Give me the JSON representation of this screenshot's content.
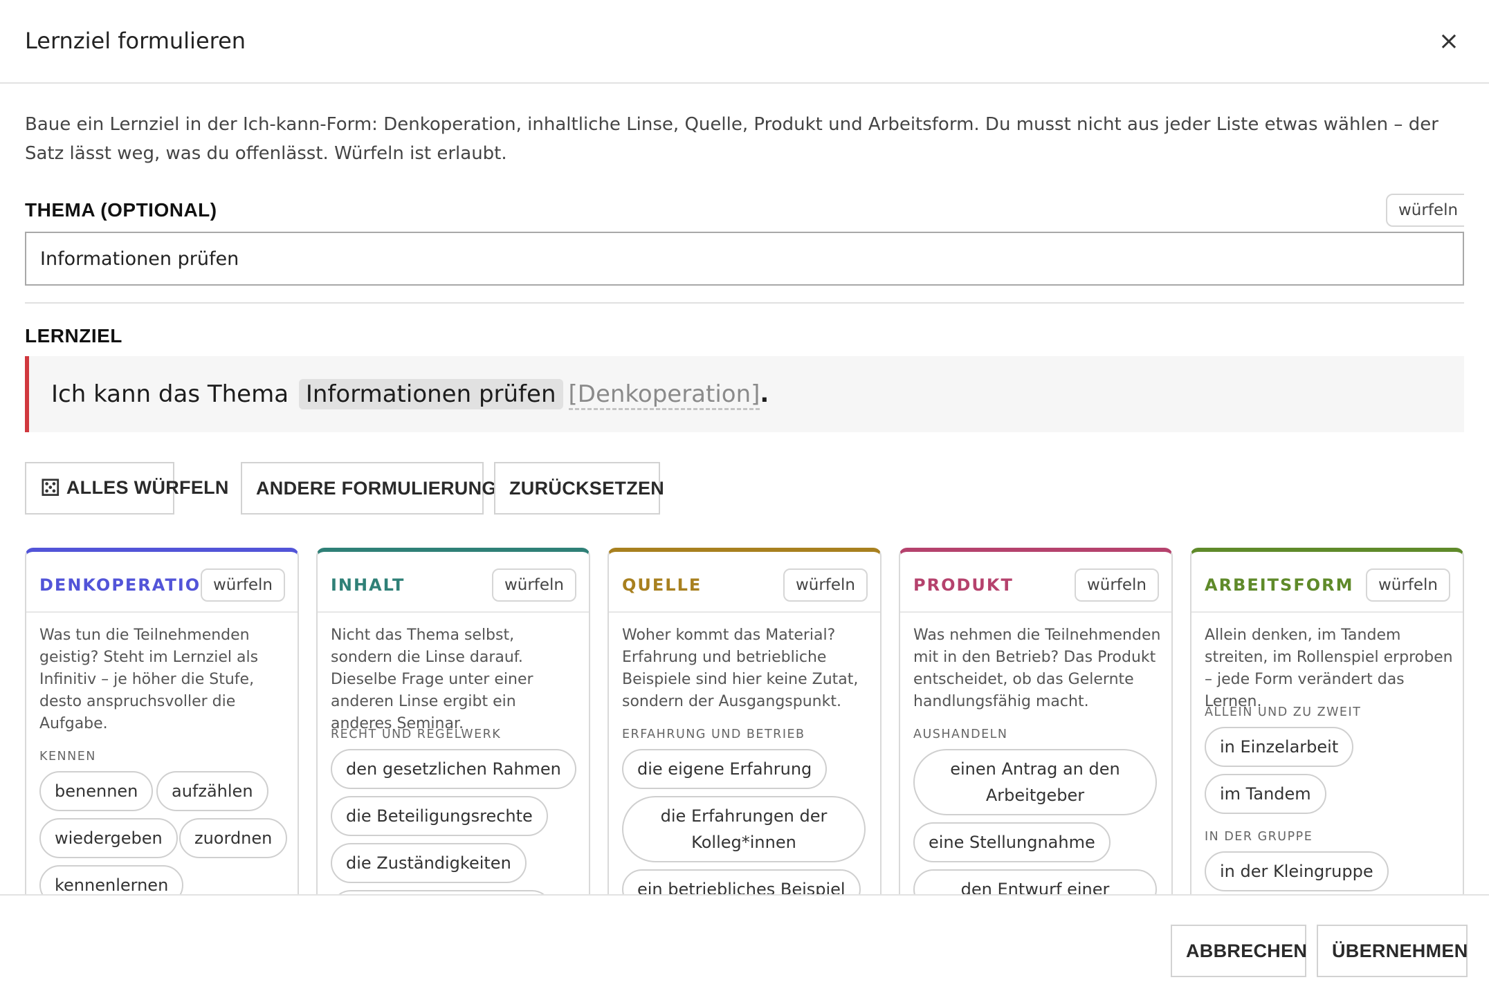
{
  "dialog": {
    "title": "Lernziel formulieren",
    "close_label": "×"
  },
  "intro": "Baue ein Lernziel in der Ich-kann-Form: Denkoperation, inhaltliche Linse, Quelle, Produkt und Arbeitsform. Du musst nicht aus jeder Liste etwas wählen – der Satz lässt weg, was du offenlässt. Würfeln ist erlaubt.",
  "topic": {
    "label": "THEMA (OPTIONAL)",
    "roll_label": "würfeln",
    "value": "Informationen prüfen"
  },
  "goal": {
    "label": "LERNZIEL",
    "prefix": "Ich kann das Thema",
    "topic": "Informationen prüfen",
    "placeholder": "[Denkoperation]",
    "period": "."
  },
  "actions": {
    "dice_icon": "⚄",
    "roll_all": "ALLES WÜRFELN",
    "rephrase": "ANDERE FORMULIERUNG",
    "reset": "ZURÜCKSETZEN"
  },
  "colors": {
    "denkoperation": "#5254d8",
    "inhalt": "#2f8077",
    "quelle": "#a8801f",
    "produkt": "#b5426d",
    "arbeitsform": "#5f8a2a",
    "goal_accent": "#d0383e"
  },
  "columns": [
    {
      "title": "DENKOPERATION",
      "roll_label": "würfeln",
      "description": "Was tun die Teilnehmenden geistig? Steht im Lernziel als Infinitiv – je höher die Stufe, desto anspruchsvoller die Aufgabe.",
      "groups": [
        {
          "label": "KENNEN"
        }
      ],
      "items": [
        "benennen",
        "aufzählen",
        "wiedergeben",
        "zuordnen",
        "kennenlernen"
      ]
    },
    {
      "title": "INHALT",
      "roll_label": "würfeln",
      "description": "Nicht das Thema selbst, sondern die Linse darauf. Dieselbe Frage unter einer anderen Linse ergibt ein anderes Seminar.",
      "groups": [
        {
          "label": "RECHT UND REGELWERK"
        }
      ],
      "items": [
        "den gesetzlichen Rahmen",
        "die Beteiligungsrechte",
        "die Zuständigkeiten"
      ]
    },
    {
      "title": "QUELLE",
      "roll_label": "würfeln",
      "description": "Woher kommt das Material? Erfahrung und betriebliche Beispiele sind hier keine Zutat, sondern der Ausgangspunkt.",
      "groups": [
        {
          "label": "ERFAHRUNG UND BETRIEB"
        }
      ],
      "items": [
        "die eigene Erfahrung",
        "die Erfahrungen der Kolleg*innen",
        "ein betriebliches Beispiel"
      ]
    },
    {
      "title": "PRODUKT",
      "roll_label": "würfeln",
      "description": "Was nehmen die Teilnehmenden mit in den Betrieb? Das Produkt entscheidet, ob das Gelernte handlungsfähig macht.",
      "groups": [
        {
          "label": "AUSHANDELN"
        }
      ],
      "items": [
        "einen Antrag an den Arbeitgeber",
        "eine Stellungnahme",
        "den Entwurf einer"
      ]
    },
    {
      "title": "ARBEITSFORM",
      "roll_label": "würfeln",
      "description": "Allein denken, im Tandem streiten, im Rollenspiel erproben – jede Form verändert das Lernen.",
      "groups": [
        {
          "label": "ALLEIN UND ZU ZWEIT"
        },
        {
          "label": "IN DER GRUPPE"
        }
      ],
      "items": [
        "in Einzelarbeit",
        "im Tandem",
        "in der Kleingruppe"
      ]
    }
  ],
  "footer": {
    "cancel": "ABBRECHEN",
    "apply": "ÜBERNEHMEN"
  }
}
